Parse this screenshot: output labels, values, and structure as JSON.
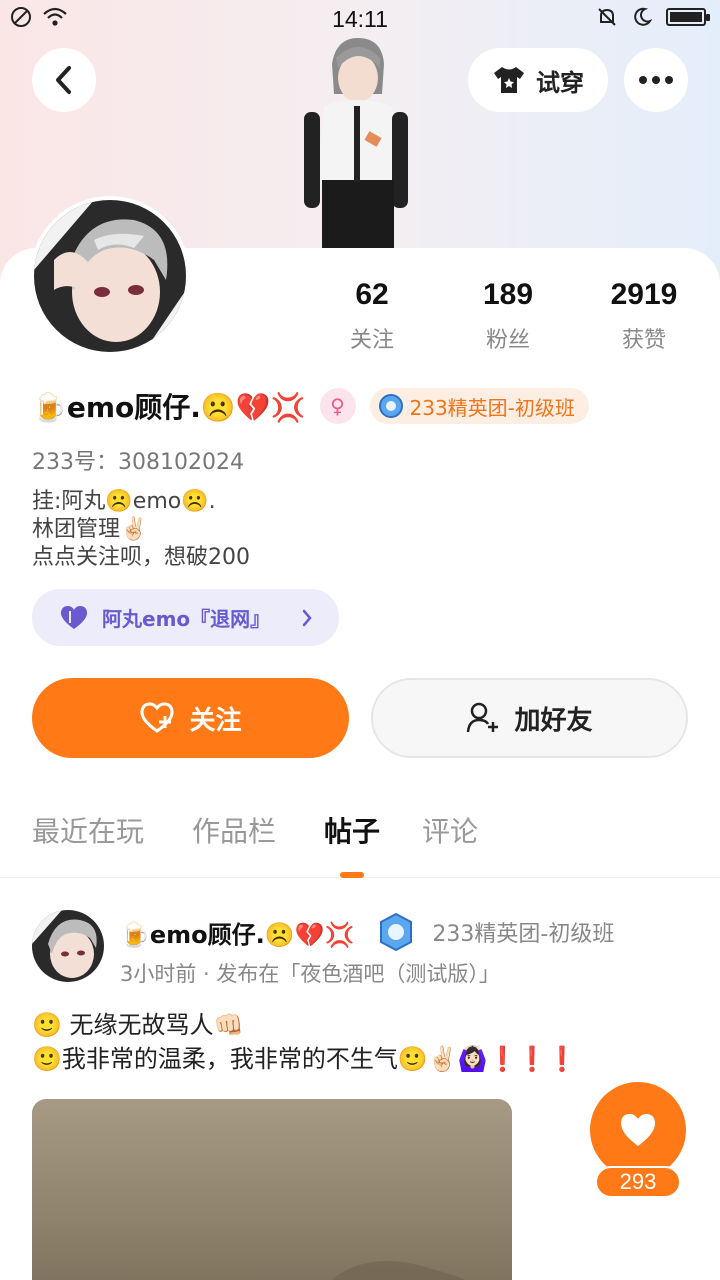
{
  "status_bar": {
    "time": "14:11"
  },
  "header": {
    "tryon_label": "试穿"
  },
  "profile": {
    "stats": [
      {
        "value": "62",
        "label": "关注"
      },
      {
        "value": "189",
        "label": "粉丝"
      },
      {
        "value": "2919",
        "label": "获赞"
      }
    ],
    "name": "🍺emo顾仔.☹️💔💢",
    "title_badge": "233精英团-初级班",
    "account_id": "233号：308102024",
    "bio_lines": [
      "挂:阿丸☹️emo☹️.",
      "林团管理✌🏻",
      "点点关注呗，想破200"
    ],
    "group_label": "阿丸emo『退网』"
  },
  "actions": {
    "follow_label": "关注",
    "add_friend_label": "加好友"
  },
  "tabs": [
    {
      "label": "最近在玩",
      "active": false
    },
    {
      "label": "作品栏",
      "active": false
    },
    {
      "label": "帖子",
      "active": true
    },
    {
      "label": "评论",
      "active": false
    }
  ],
  "post": {
    "author": "🍺emo顾仔.☹️💔💢",
    "author_badge": "233精英团-初级班",
    "meta": "3小时前 · 发布在「夜色酒吧（测试版）」",
    "text_lines": [
      "🙂      无缘无故骂人👊🏻",
      "🙂我非常的温柔，我非常的不生气🙂✌🏻🙆🏻‍♀️❗❗❗"
    ],
    "like_count": "293"
  },
  "colors": {
    "accent": "#ff7a17",
    "group_pill_bg": "#ececfb",
    "group_pill_text": "#6a5ad0"
  }
}
